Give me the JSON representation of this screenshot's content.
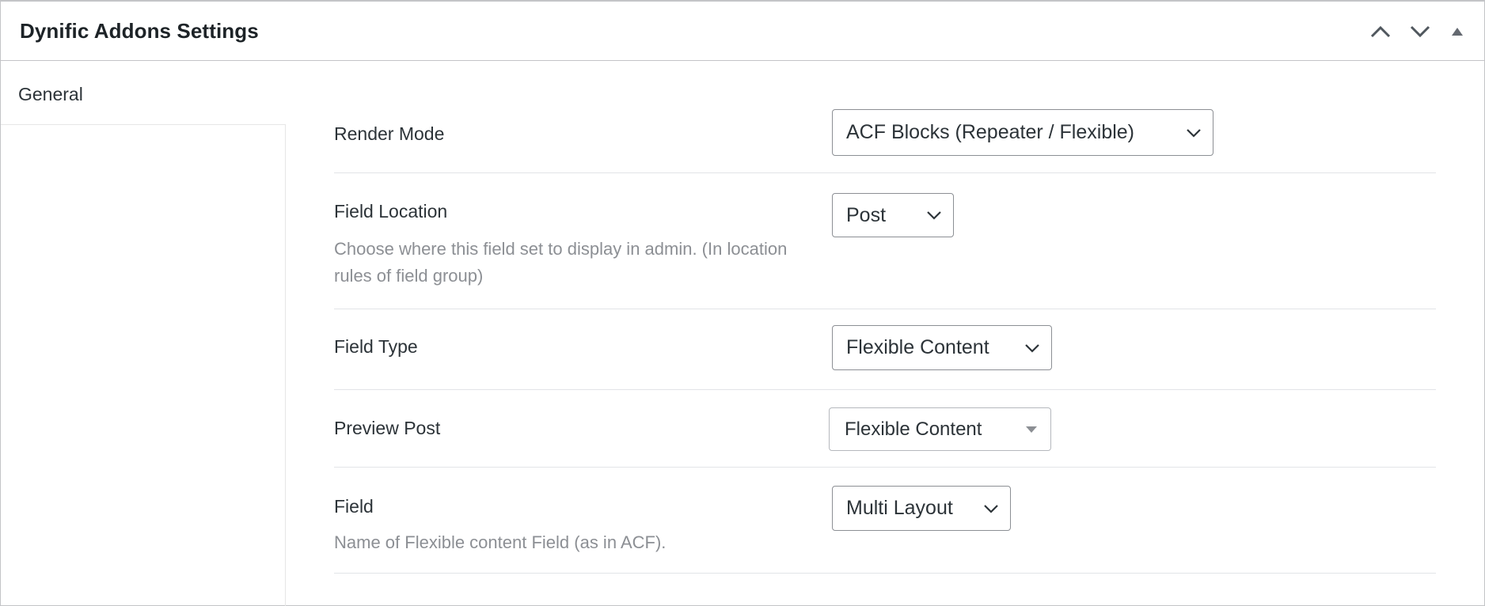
{
  "header": {
    "title": "Dynific Addons Settings",
    "controls": [
      "chevron-up-icon",
      "chevron-down-icon",
      "triangle-up-icon"
    ]
  },
  "tabs": {
    "general": "General"
  },
  "rows": [
    {
      "label": "Render Mode",
      "value": "ACF Blocks (Repeater / Flexible)"
    },
    {
      "label": "Field Location",
      "value": "Post",
      "description": "Choose where this field set to display in admin. (In location rules of field group)"
    },
    {
      "label": "Field Type",
      "value": "Flexible Content"
    },
    {
      "label": "Preview Post",
      "value": "Flexible Content"
    },
    {
      "label": "Field",
      "value": "Multi Layout",
      "description": "Name of Flexible content Field (as in ACF)."
    }
  ],
  "colors": {
    "border": "#c3c4c7",
    "text": "#1d2327",
    "description": "#8c8f94",
    "icon": "#50575e"
  }
}
